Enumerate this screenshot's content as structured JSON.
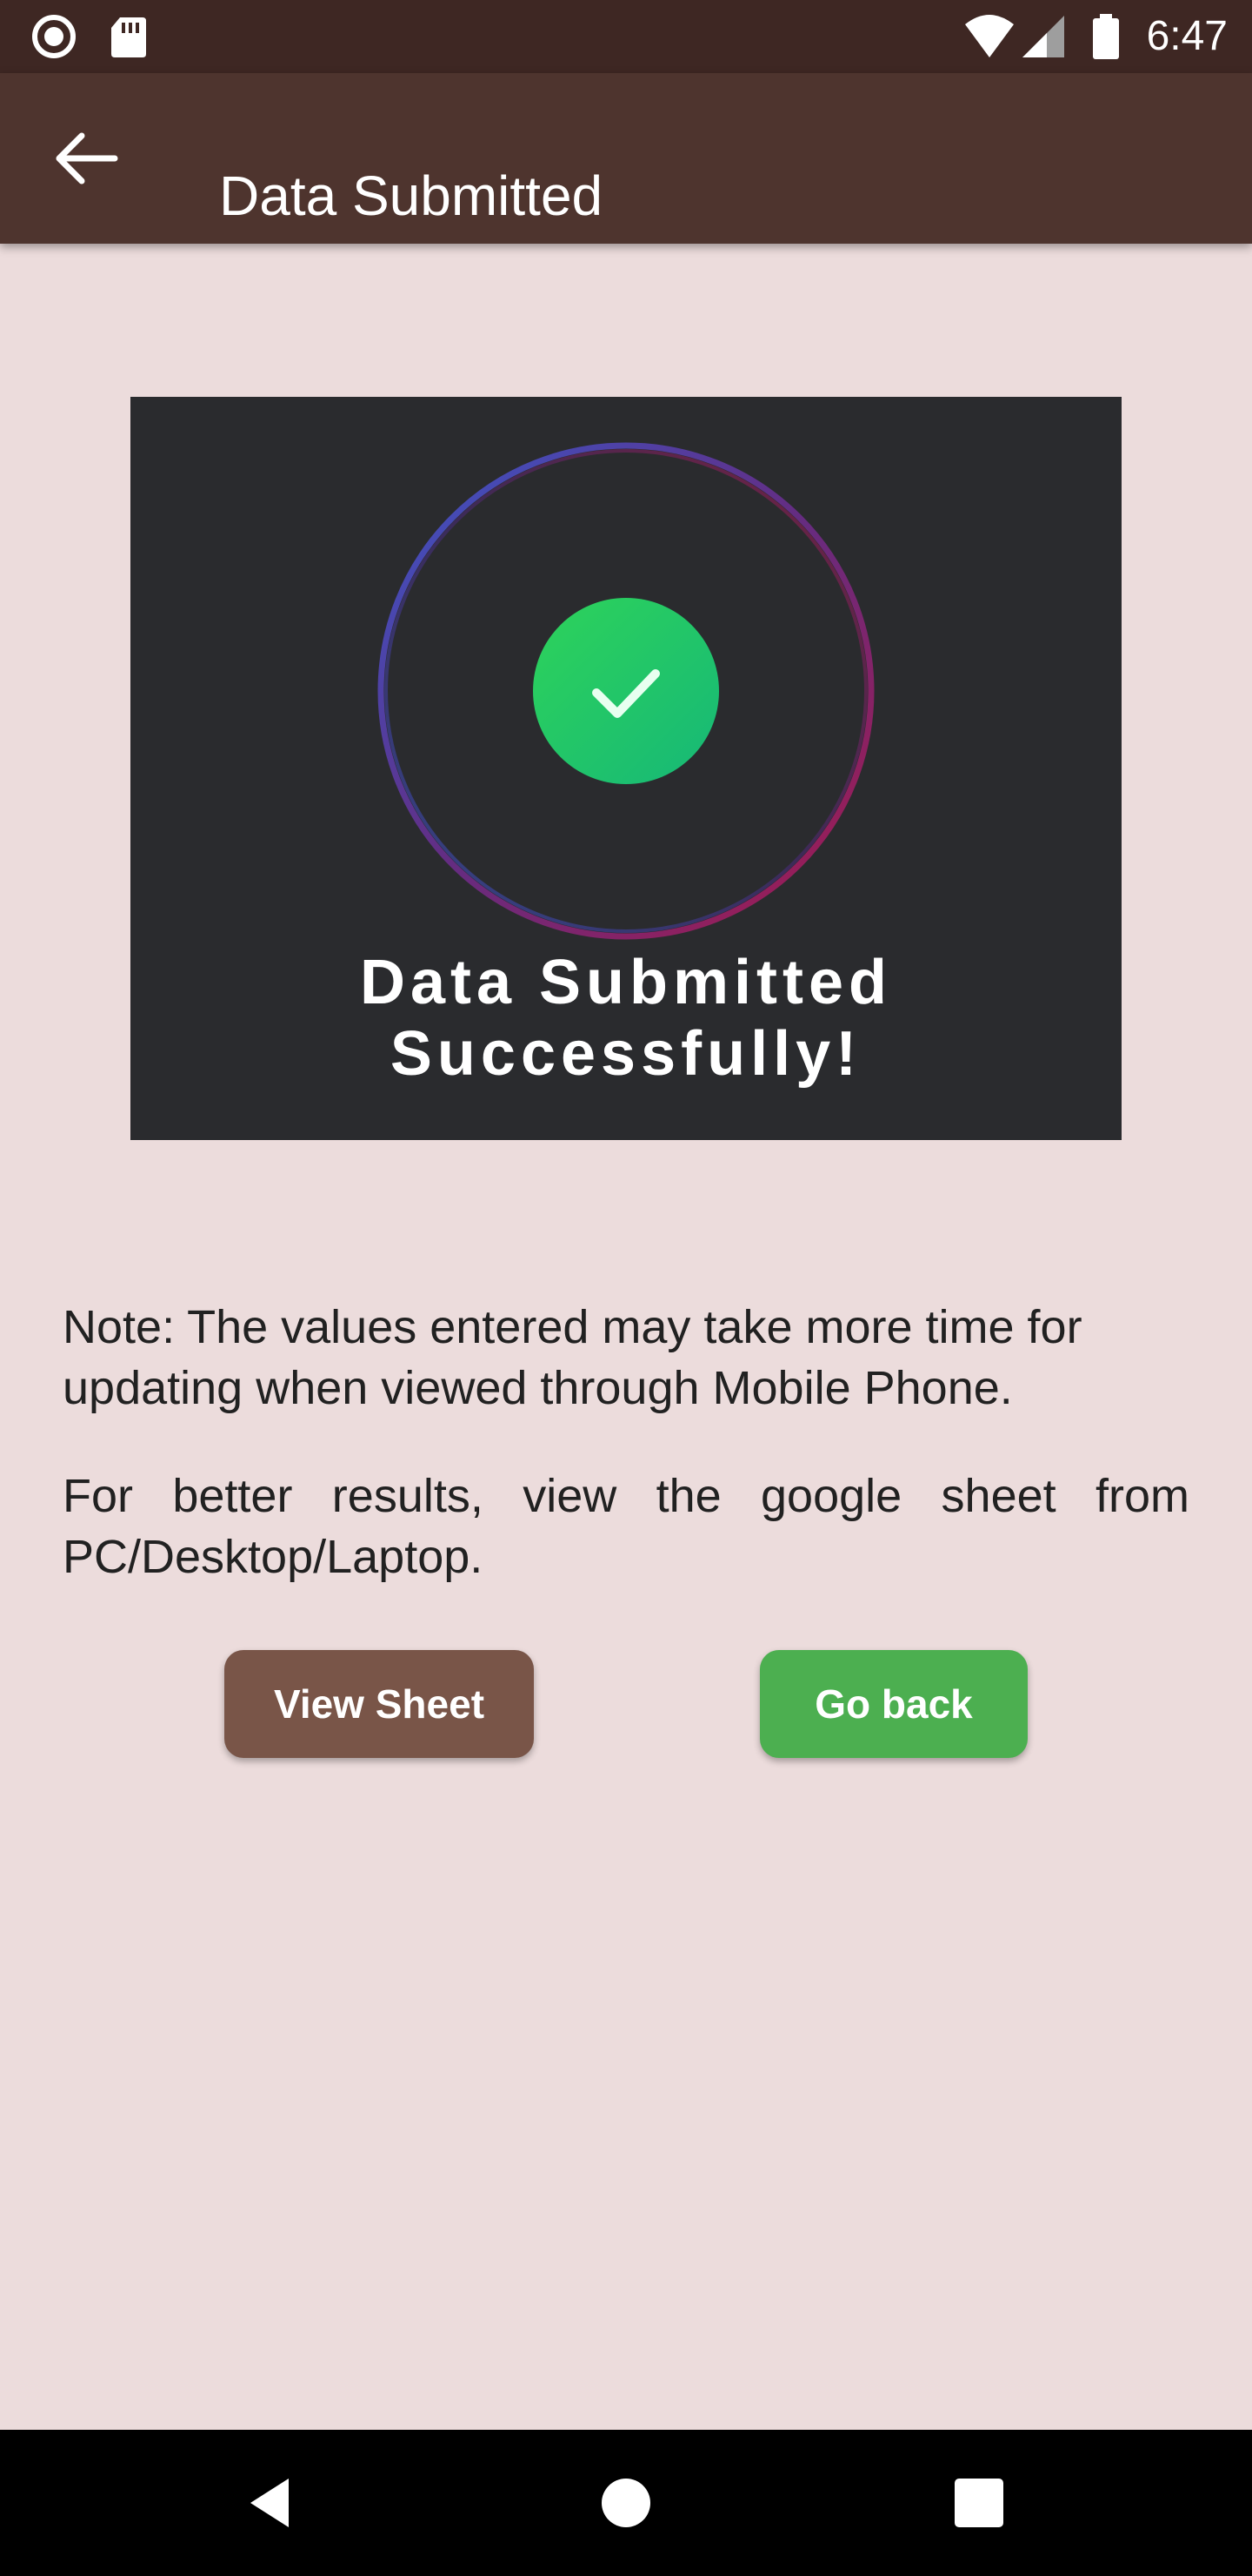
{
  "status_bar": {
    "time": "6:47",
    "icons": [
      "record-icon",
      "sd-card-icon",
      "wifi-icon",
      "signal-icon",
      "battery-icon"
    ]
  },
  "app_bar": {
    "title": "Data Submitted",
    "back_icon": "arrow-back-icon"
  },
  "banner": {
    "line1": "Data Submitted",
    "line2": "Successfully!",
    "icon": "check-circle-icon",
    "colors": {
      "background": "#2a2b2e",
      "check_circle": "#22c55e",
      "ring_blue": "#3b5bdb",
      "ring_red": "#b5174f"
    }
  },
  "notes": [
    "Note: The values entered may take more time for updating when viewed through Mobile Phone.",
    "For better results, view the google sheet from PC/Desktop/Laptop."
  ],
  "buttons": {
    "view_sheet": "View Sheet",
    "go_back": "Go back"
  },
  "nav_bar": {
    "icons": [
      "nav-back-icon",
      "nav-home-icon",
      "nav-recents-icon"
    ]
  },
  "colors": {
    "status_bar": "#3e2723",
    "app_bar": "#4e342e",
    "background": "#ecdcdc",
    "view_sheet_button": "#795548",
    "go_back_button": "#4caf50"
  }
}
